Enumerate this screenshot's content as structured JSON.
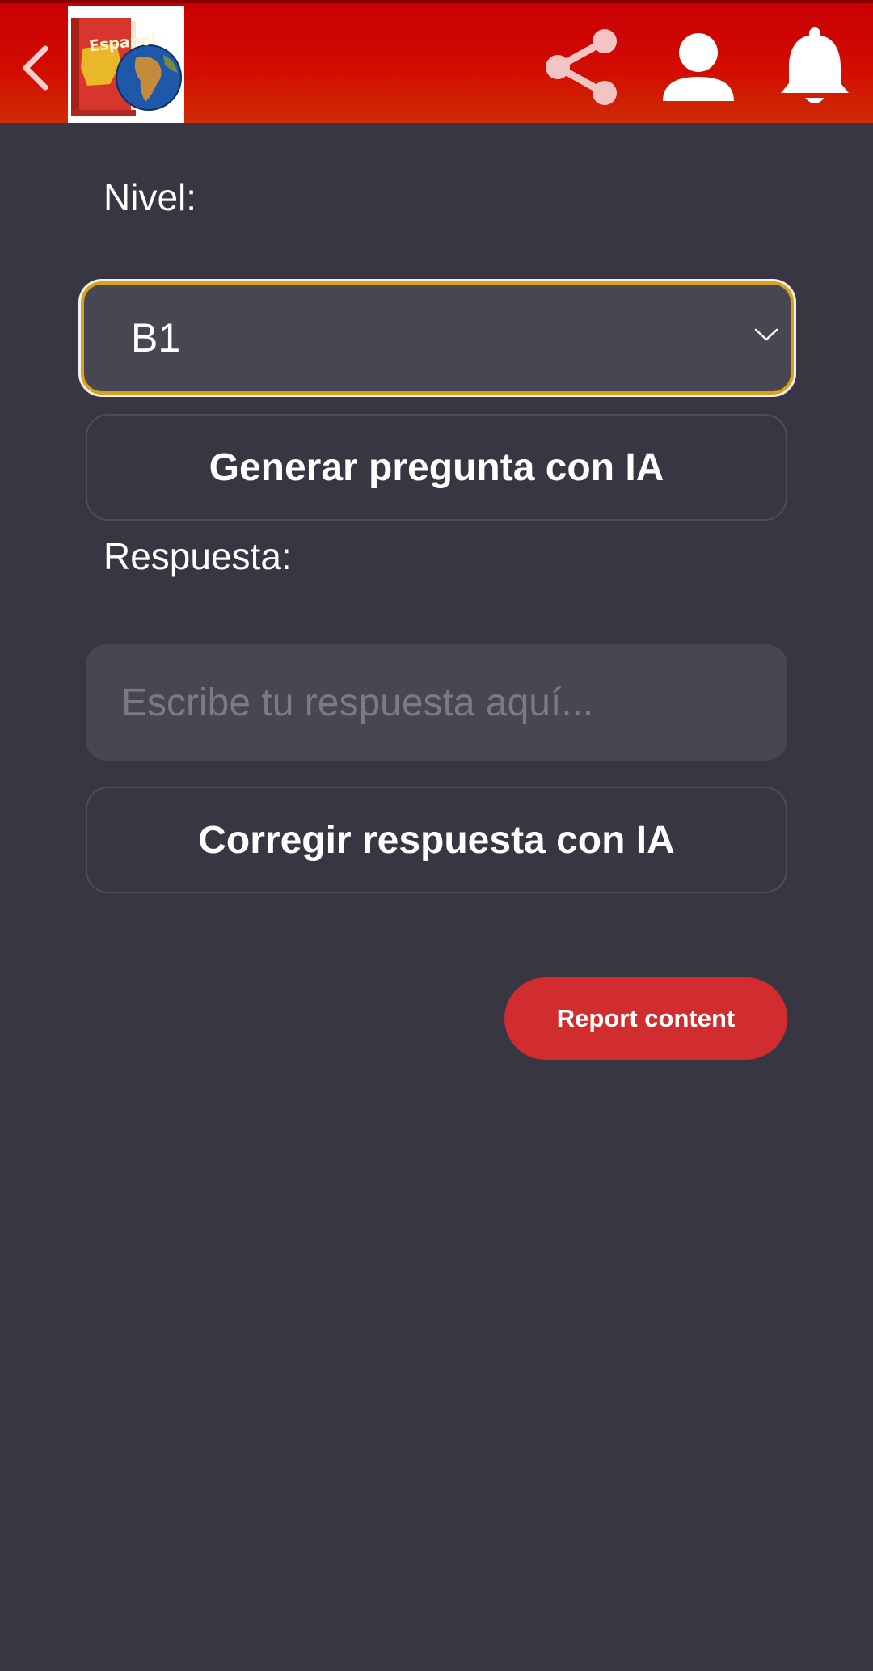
{
  "app": {
    "logo_text": "Español"
  },
  "header": {
    "back_icon": "chevron-left-icon",
    "share_icon": "share-icon",
    "profile_icon": "user-icon",
    "notifications_icon": "bell-icon"
  },
  "form": {
    "level_label": "Nivel:",
    "level_value": "B1",
    "generate_button": "Generar pregunta con IA",
    "answer_label": "Respuesta:",
    "answer_placeholder": "Escribe tu respuesta aquí...",
    "answer_value": "",
    "correct_button": "Corregir respuesta con IA",
    "report_button": "Report content"
  },
  "colors": {
    "header_red": "#c80004",
    "background": "#373642",
    "field": "#474753",
    "select_focus_border": "#d9a21b",
    "report_button": "#d22d2e"
  }
}
